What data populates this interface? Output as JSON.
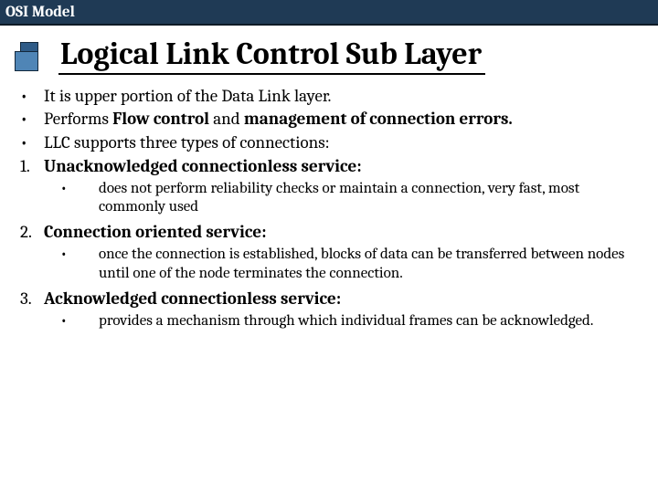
{
  "titlebar": "OSI Model",
  "heading": "Logical Link Control Sub Layer",
  "bullet_marker": "•",
  "bullets": [
    {
      "pre": "It is upper portion of the Data Link layer.",
      "bold": "",
      "post": ""
    },
    {
      "pre": "Performs ",
      "bold": "Flow control",
      "post": " and ",
      "bold2": "management of connection errors.",
      "post2": ""
    },
    {
      "pre": "LLC supports three types of connections:",
      "bold": "",
      "post": ""
    }
  ],
  "items": [
    {
      "num": "1.",
      "title": "Unacknowledged connectionless service:",
      "desc": "does not perform reliability checks or maintain a connection, very fast, most commonly used"
    },
    {
      "num": "2.",
      "title": "Connection oriented service:",
      "desc": "once the connection is established, blocks of data can be transferred between nodes until one of the node terminates the connection."
    },
    {
      "num": "3.",
      "title": "Acknowledged connectionless service:",
      "desc": "provides a mechanism through which individual frames can be acknowledged."
    }
  ]
}
